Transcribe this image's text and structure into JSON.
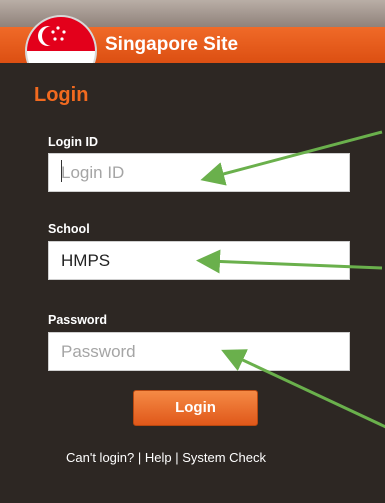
{
  "header": {
    "site_title": "Singapore Site",
    "flag_icon": "singapore-flag-icon",
    "brand_color": "#e85a1a"
  },
  "form": {
    "heading": "Login",
    "login_id": {
      "label": "Login ID",
      "placeholder": "Login ID",
      "value": ""
    },
    "school": {
      "label": "School",
      "value": "HMPS"
    },
    "password": {
      "label": "Password",
      "placeholder": "Password",
      "value": ""
    },
    "submit_label": "Login"
  },
  "footer_links": {
    "cant_login": "Can't login?",
    "separator": " | ",
    "help": "Help",
    "system_check": "System Check"
  },
  "annotations": {
    "arrow_color": "#6ab04c",
    "arrow_count": 4
  }
}
